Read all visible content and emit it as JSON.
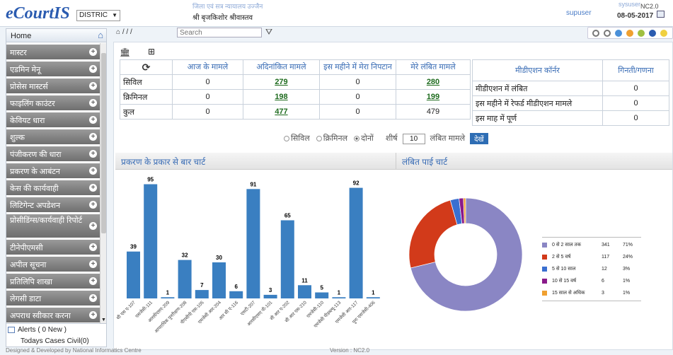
{
  "header": {
    "app_name": "eCourtIS",
    "establishment_select": "DISTRIC",
    "court_subtitle": "जिला एवं सत्र न्यायालय उज्जैन",
    "judge_name": "श्री बृजकिशोर श्रीवास्तव",
    "user": "supuser",
    "system_user": "sysuser",
    "version_badge": "NC2.0",
    "date": "08-05-2017"
  },
  "sidebar": {
    "home": "Home",
    "items": [
      {
        "label": "मास्टर"
      },
      {
        "label": "एडमिन मेनू"
      },
      {
        "label": "प्रोसेस मास्टर्स"
      },
      {
        "label": "फाइलिंग काउंटर"
      },
      {
        "label": "केवियट धारा"
      },
      {
        "label": "शुल्क"
      },
      {
        "label": "पंजीकरण की धारा"
      },
      {
        "label": "प्रकरण के आबंटन"
      },
      {
        "label": "केस की कार्यवाही"
      },
      {
        "label": "लिटिगेन्ट अपडेशन"
      },
      {
        "label": "प्रोसीडिंग्स/कार्यवाही रिपोर्ट"
      },
      {
        "label": "टीनेपीएमसी"
      },
      {
        "label": "अपील सूचना"
      },
      {
        "label": "प्रतिलिपि शाखा"
      },
      {
        "label": "लेगसी डाटा"
      },
      {
        "label": "अपराध स्वीकार करना"
      }
    ],
    "alerts": "Alerts ( 0 New )",
    "todays_cases": "Todays Cases Civil(0)"
  },
  "toolbar": {
    "path": "/ / /",
    "search_placeholder": "Search"
  },
  "theme_colors": [
    "#ffffff",
    "#ffffff",
    "#4a90d9",
    "#f0a030",
    "#a0c040",
    "#2a5bb0",
    "#f0d040"
  ],
  "case_table": {
    "headers": [
      "आज के मामले",
      "अदिनांकित मामले",
      "इस महीने में मेरा निपटान",
      "मेरे लंबित मामले"
    ],
    "rows": [
      {
        "label": "सिविल",
        "today": "0",
        "undated": "279",
        "disposed": "0",
        "pending": "280"
      },
      {
        "label": "क्रिमिनल",
        "today": "0",
        "undated": "198",
        "disposed": "0",
        "pending": "199"
      },
      {
        "label": "कुल",
        "today": "0",
        "undated": "477",
        "disposed": "0",
        "pending": "479"
      }
    ]
  },
  "mediation": {
    "headers": [
      "मीडीएशन कॉर्नर",
      "गिनती/गणना"
    ],
    "rows": [
      {
        "label": "मीडीएशन में लंबित",
        "count": "0"
      },
      {
        "label": "इस महीने में रेफर्ड मीडीएशन मामले",
        "count": "0"
      },
      {
        "label": "इस माह में पूर्ण",
        "count": "0"
      }
    ]
  },
  "filter": {
    "civil": "सिविल",
    "criminal": "क्रिमिनल",
    "both": "दोनों",
    "top_label": "शीर्ष",
    "top_value": "10",
    "pending_label": "लंबित मामले",
    "show_button": "देखें"
  },
  "panels": {
    "bar_title": "प्रकरण के प्रकार से बार चार्ट",
    "pie_title": "लंबित पाई चार्ट"
  },
  "chart_data": [
    {
      "type": "bar",
      "categories": [
        "सी एस ए-107",
        "एसजेसी-111",
        "आरसीएसए-209",
        "आपराधिक पुनरीक्षण-208",
        "पीएसीपी एस-105",
        "एमजेसी आर-204",
        "आर सी ए-116",
        "एसटी-207",
        "आरसीएसए पी-101",
        "सी आर ए-202",
        "सी आर एस-210",
        "एमजेसी-110",
        "एमजेसी पीडब्ल्यू-113",
        "एमजेसी आर-117",
        "पुनः एसजेसी-406"
      ],
      "values": [
        39,
        95,
        1,
        32,
        7,
        30,
        6,
        91,
        3,
        65,
        11,
        5,
        1,
        92,
        1
      ],
      "ylim": [
        0,
        100
      ],
      "color": "#3a7fc1"
    },
    {
      "type": "pie",
      "donut": true,
      "legend_position": "right",
      "slices": [
        {
          "label": "0 से 2 साल तक",
          "value": 341,
          "percent": "71%",
          "color": "#8a86c4"
        },
        {
          "label": "2 से 5 वर्ष",
          "value": 117,
          "percent": "24%",
          "color": "#d23a1a"
        },
        {
          "label": "5 से 10 साल",
          "value": 12,
          "percent": "3%",
          "color": "#3a6fd0"
        },
        {
          "label": "10 से 15 वर्ष",
          "value": 6,
          "percent": "1%",
          "color": "#8a1a8a"
        },
        {
          "label": "15 साल से अधिक",
          "value": 3,
          "percent": "1%",
          "color": "#f0a030"
        }
      ]
    }
  ],
  "footer": {
    "designed_by": "Designed & Developed by National Informatics Centre",
    "version": "Version : NC2.0"
  }
}
